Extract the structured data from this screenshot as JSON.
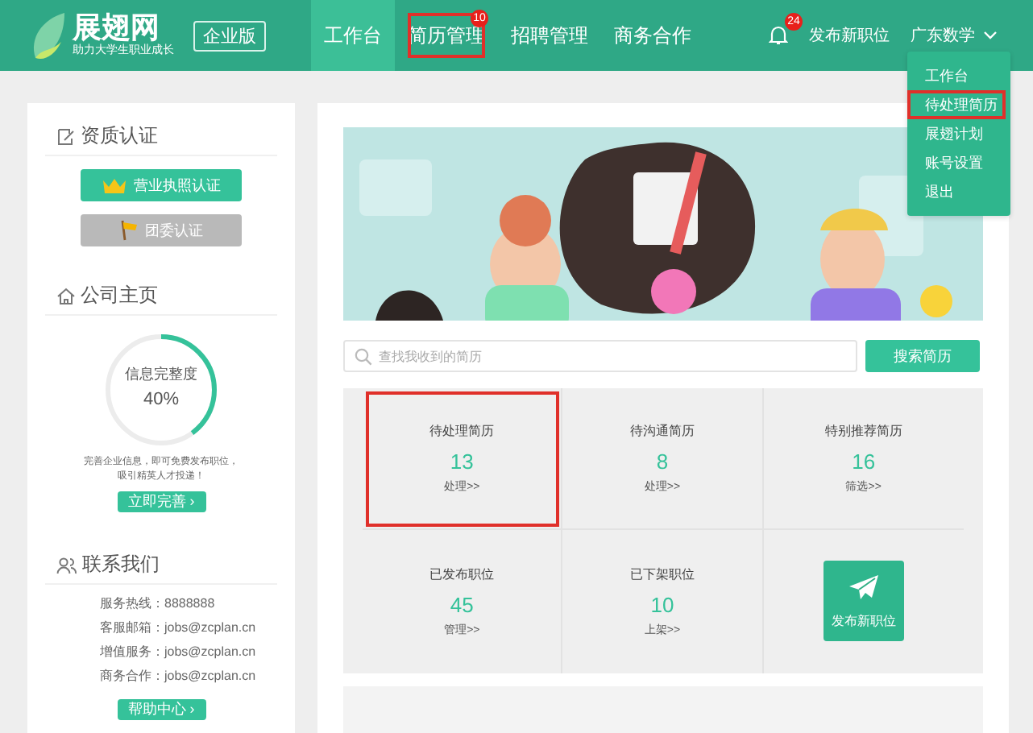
{
  "header": {
    "logo": {
      "title": "展翅网",
      "slogan": "助力大学生职业成长"
    },
    "edition": "企业版",
    "nav": [
      {
        "label": "工作台",
        "selected": true,
        "highlighted": false
      },
      {
        "label": "简历管理",
        "selected": false,
        "highlighted": true,
        "badge": "10"
      },
      {
        "label": "招聘管理",
        "selected": false,
        "highlighted": false
      },
      {
        "label": "商务合作",
        "selected": false,
        "highlighted": false
      }
    ],
    "notifications": {
      "badge": "24"
    },
    "post_job": "发布新职位",
    "user": "广东数学"
  },
  "user_menu": [
    {
      "label": "工作台",
      "highlighted": false
    },
    {
      "label": "待处理简历",
      "highlighted": true
    },
    {
      "label": "展翅计划",
      "highlighted": false
    },
    {
      "label": "账号设置",
      "highlighted": false
    },
    {
      "label": "退出",
      "highlighted": false
    }
  ],
  "sidebar": {
    "certification": {
      "title": "资质认证",
      "buttons": [
        {
          "label": "营业执照认证",
          "disabled": false,
          "kind": "crown"
        },
        {
          "label": "团委认证",
          "disabled": true,
          "kind": "flag"
        }
      ]
    },
    "company_page": {
      "title": "公司主页",
      "progress": {
        "label": "信息完整度",
        "reading": "40%",
        "level": 0.4
      },
      "hint": [
        "完善企业信息，即可免费发布职位，",
        "吸引精英人才投递！"
      ],
      "button": "立即完善 ›"
    },
    "contact": {
      "title": "联系我们",
      "lines": [
        {
          "label": "服务热线：",
          "value": "8888888"
        },
        {
          "label": "客服邮箱：",
          "value": "jobs@zcplan.cn"
        },
        {
          "label": "增值服务：",
          "value": "jobs@zcplan.cn"
        },
        {
          "label": "商务合作：",
          "value": "jobs@zcplan.cn"
        }
      ],
      "button": "帮助中心 ›"
    }
  },
  "main": {
    "search": {
      "placeholder": "查找我收到的简历",
      "button": "搜索简历"
    },
    "stats": [
      {
        "title": "待处理简历",
        "value": "13",
        "action": "处理>>",
        "highlighted": true
      },
      {
        "title": "待沟通简历",
        "value": "8",
        "action": "处理>>",
        "highlighted": false
      },
      {
        "title": "特别推荐简历",
        "value": "16",
        "action": "筛选>>",
        "highlighted": false
      },
      {
        "title": "已发布职位",
        "value": "45",
        "action": "管理>>",
        "highlighted": false
      },
      {
        "title": "已下架职位",
        "value": "10",
        "action": "上架>>",
        "highlighted": false
      }
    ],
    "publish_button": "发布新职位"
  }
}
